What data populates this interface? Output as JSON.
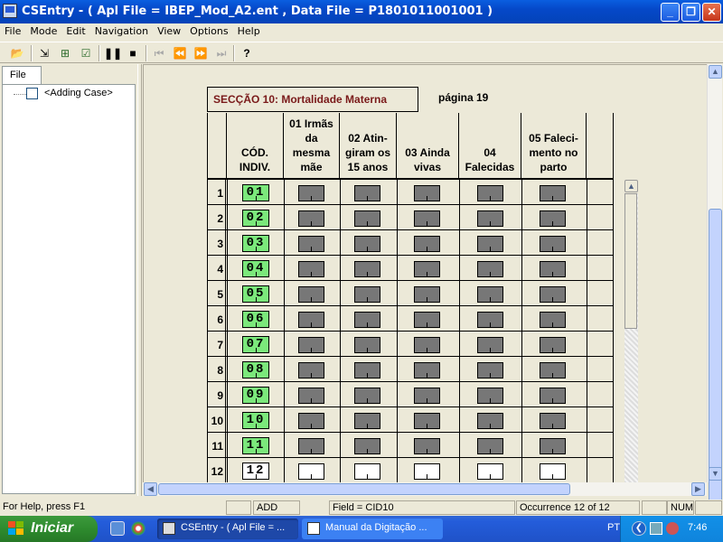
{
  "window": {
    "title": "CSEntry - ( Apl File = IBEP_Mod_A2.ent , Data File = P1801011001001 )",
    "min_label": "_",
    "max_label": "❐",
    "close_label": "✕"
  },
  "menu": [
    "File",
    "Mode",
    "Edit",
    "Navigation",
    "View",
    "Options",
    "Help"
  ],
  "tree": {
    "tab_label": "File",
    "case_label": "<Adding Case>"
  },
  "form": {
    "section_title": "SECÇÃO 10: Mortalidade Materna",
    "page_label": "página 19",
    "headers": {
      "cod": "CÓD.\nINDIV.",
      "c1": "01 Irmãs\nda\nmesma\nmãe",
      "c2": "02 Atin-\ngiram os\n15 anos",
      "c3": "03 Ainda\nvivas",
      "c4": "04\nFalecidas",
      "c5": "05 Faleci-\nmento no\nparto"
    },
    "rows": [
      {
        "num": "1",
        "cod": "01",
        "filled": true
      },
      {
        "num": "2",
        "cod": "02",
        "filled": true
      },
      {
        "num": "3",
        "cod": "03",
        "filled": true
      },
      {
        "num": "4",
        "cod": "04",
        "filled": true
      },
      {
        "num": "5",
        "cod": "05",
        "filled": true
      },
      {
        "num": "6",
        "cod": "06",
        "filled": true
      },
      {
        "num": "7",
        "cod": "07",
        "filled": true
      },
      {
        "num": "8",
        "cod": "08",
        "filled": true
      },
      {
        "num": "9",
        "cod": "09",
        "filled": true
      },
      {
        "num": "10",
        "cod": "10",
        "filled": true
      },
      {
        "num": "11",
        "cod": "11",
        "filled": true
      },
      {
        "num": "12",
        "cod": "12",
        "filled": false
      }
    ]
  },
  "status": {
    "help": "For Help, press F1",
    "mode": "ADD",
    "field": "Field = CID10",
    "occurrence": "Occurrence 12 of 12",
    "num": "NUM"
  },
  "taskbar": {
    "start_label": "Iniciar",
    "tasks": [
      "CSEntry - ( Apl File = ...",
      "Manual da Digitação ..."
    ],
    "lang": "PT",
    "clock": "7:46"
  },
  "colors": {
    "filled_code": "#7be87b",
    "section_title": "#7a1a1a",
    "filled_cell": "#777777"
  }
}
